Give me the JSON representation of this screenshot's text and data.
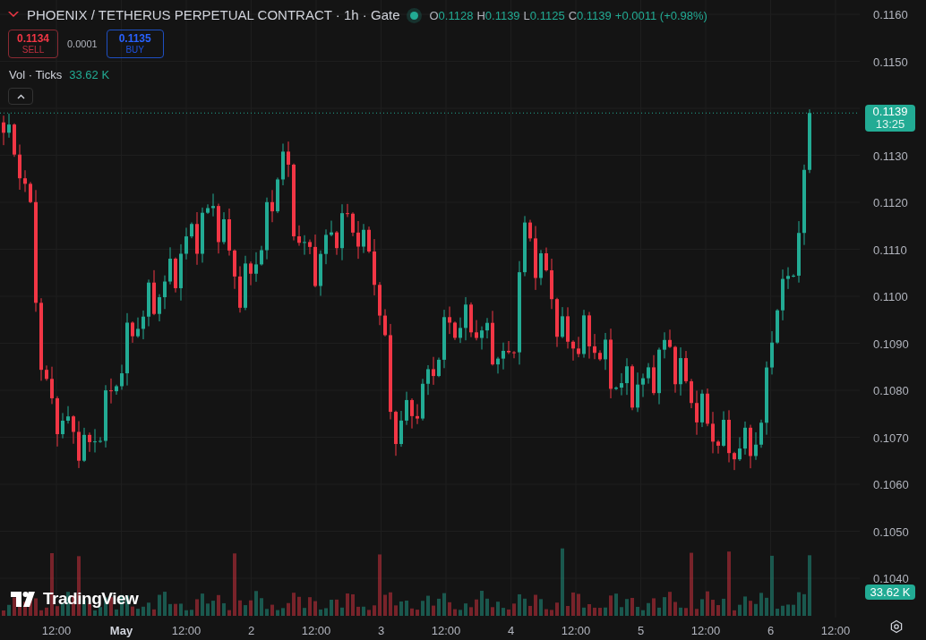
{
  "header": {
    "title": "PHOENIX / TETHERUS PERPETUAL CONTRACT · 1h · Gate",
    "ohlc": [
      {
        "label": "O",
        "value": "0.1128"
      },
      {
        "label": "H",
        "value": "0.1139"
      },
      {
        "label": "L",
        "value": "0.1125"
      },
      {
        "label": "C",
        "value": "0.1139"
      }
    ],
    "change": "+0.0011 (+0.98%)"
  },
  "trade": {
    "sell": {
      "price": "0.1134",
      "label": "SELL"
    },
    "spread": "0.0001",
    "buy": {
      "price": "0.1135",
      "label": "BUY"
    }
  },
  "volume_legend": {
    "label": "Vol · Ticks",
    "value": "33.62 K"
  },
  "logo": "TradingView",
  "price_axis": {
    "ticks": [
      "0.1160",
      "0.1150",
      "0.1130",
      "0.1120",
      "0.1110",
      "0.1100",
      "0.1090",
      "0.1080",
      "0.1070",
      "0.1060",
      "0.1050",
      "0.1040"
    ],
    "last_price": {
      "price": "0.1139",
      "countdown": "13:25"
    },
    "volume_value": "33.62 K"
  },
  "time_axis": [
    "12:00",
    "May",
    "12:00",
    "2",
    "12:00",
    "3",
    "12:00",
    "4",
    "12:00",
    "5",
    "12:00",
    "6",
    "12:00"
  ]
}
